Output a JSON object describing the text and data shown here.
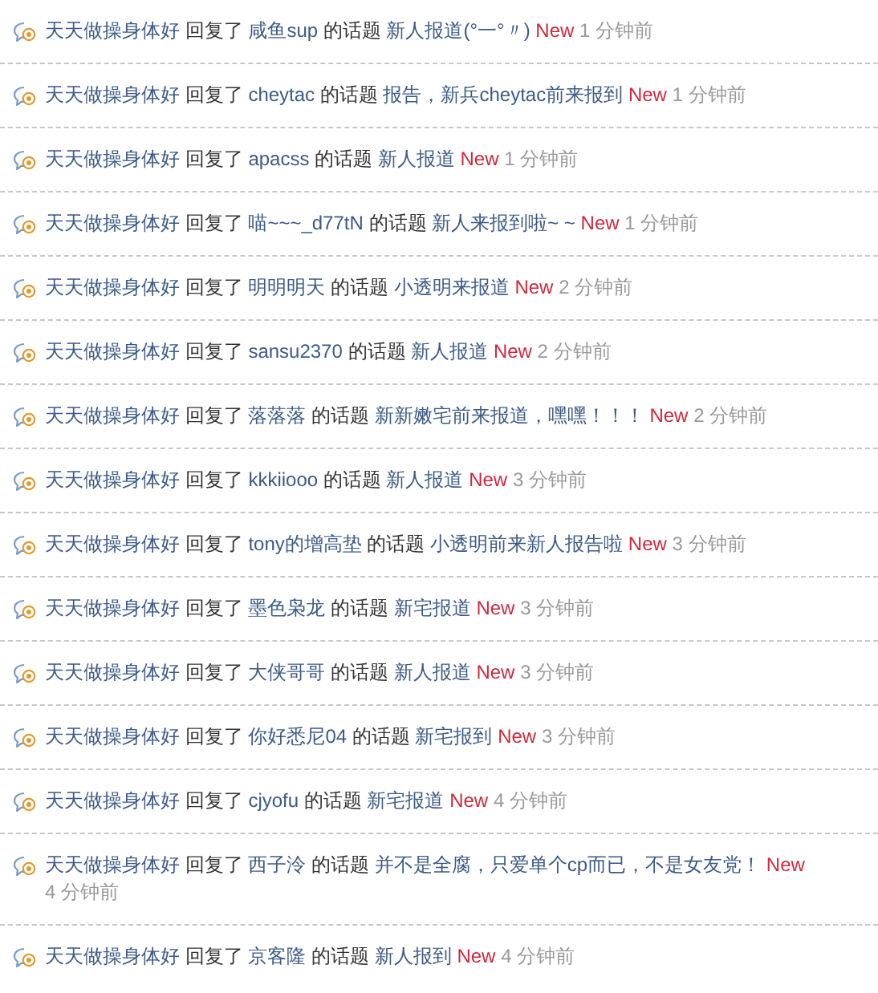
{
  "feed": [
    {
      "user": "天天做操身体好",
      "action": "回复了",
      "author": "咸鱼sup",
      "of_topic": "的话题",
      "topic": "新人报道(°一°〃)",
      "badge": "New",
      "time": "1 分钟前"
    },
    {
      "user": "天天做操身体好",
      "action": "回复了",
      "author": "cheytac",
      "of_topic": "的话题",
      "topic": "报告，新兵cheytac前来报到",
      "badge": "New",
      "time": "1 分钟前"
    },
    {
      "user": "天天做操身体好",
      "action": "回复了",
      "author": "apacss",
      "of_topic": "的话题",
      "topic": "新人报道",
      "badge": "New",
      "time": "1 分钟前"
    },
    {
      "user": "天天做操身体好",
      "action": "回复了",
      "author": "喵~~~_d77tN",
      "of_topic": "的话题",
      "topic": "新人来报到啦~ ~",
      "badge": "New",
      "time": "1 分钟前"
    },
    {
      "user": "天天做操身体好",
      "action": "回复了",
      "author": "明明明天",
      "of_topic": "的话题",
      "topic": "小透明来报道",
      "badge": "New",
      "time": "2 分钟前"
    },
    {
      "user": "天天做操身体好",
      "action": "回复了",
      "author": "sansu2370",
      "of_topic": "的话题",
      "topic": "新人报道",
      "badge": "New",
      "time": "2 分钟前"
    },
    {
      "user": "天天做操身体好",
      "action": "回复了",
      "author": "落落落",
      "of_topic": "的话题",
      "topic": "新新嫩宅前来报道，嘿嘿！！！",
      "badge": "New",
      "time": "2 分钟前"
    },
    {
      "user": "天天做操身体好",
      "action": "回复了",
      "author": "kkkiiooo",
      "of_topic": "的话题",
      "topic": "新人报道",
      "badge": "New",
      "time": "3 分钟前"
    },
    {
      "user": "天天做操身体好",
      "action": "回复了",
      "author": "tony的增高垫",
      "of_topic": "的话题",
      "topic": "小透明前来新人报告啦",
      "badge": "New",
      "time": "3 分钟前"
    },
    {
      "user": "天天做操身体好",
      "action": "回复了",
      "author": "墨色枭龙",
      "of_topic": "的话题",
      "topic": "新宅报道",
      "badge": "New",
      "time": "3 分钟前"
    },
    {
      "user": "天天做操身体好",
      "action": "回复了",
      "author": "大侠哥哥",
      "of_topic": "的话题",
      "topic": "新人报道",
      "badge": "New",
      "time": "3 分钟前"
    },
    {
      "user": "天天做操身体好",
      "action": "回复了",
      "author": "你好悉尼04",
      "of_topic": "的话题",
      "topic": "新宅报到",
      "badge": "New",
      "time": "3 分钟前"
    },
    {
      "user": "天天做操身体好",
      "action": "回复了",
      "author": "cjyofu",
      "of_topic": "的话题",
      "topic": "新宅报道",
      "badge": "New",
      "time": "4 分钟前"
    },
    {
      "user": "天天做操身体好",
      "action": "回复了",
      "author": "西子泠",
      "of_topic": "的话题",
      "topic": "并不是全腐，只爱单个cp而已，不是女友党！",
      "badge": "New",
      "time": "4 分钟前"
    },
    {
      "user": "天天做操身体好",
      "action": "回复了",
      "author": "京客隆",
      "of_topic": "的话题",
      "topic": "新人报到",
      "badge": "New",
      "time": "4 分钟前"
    }
  ]
}
